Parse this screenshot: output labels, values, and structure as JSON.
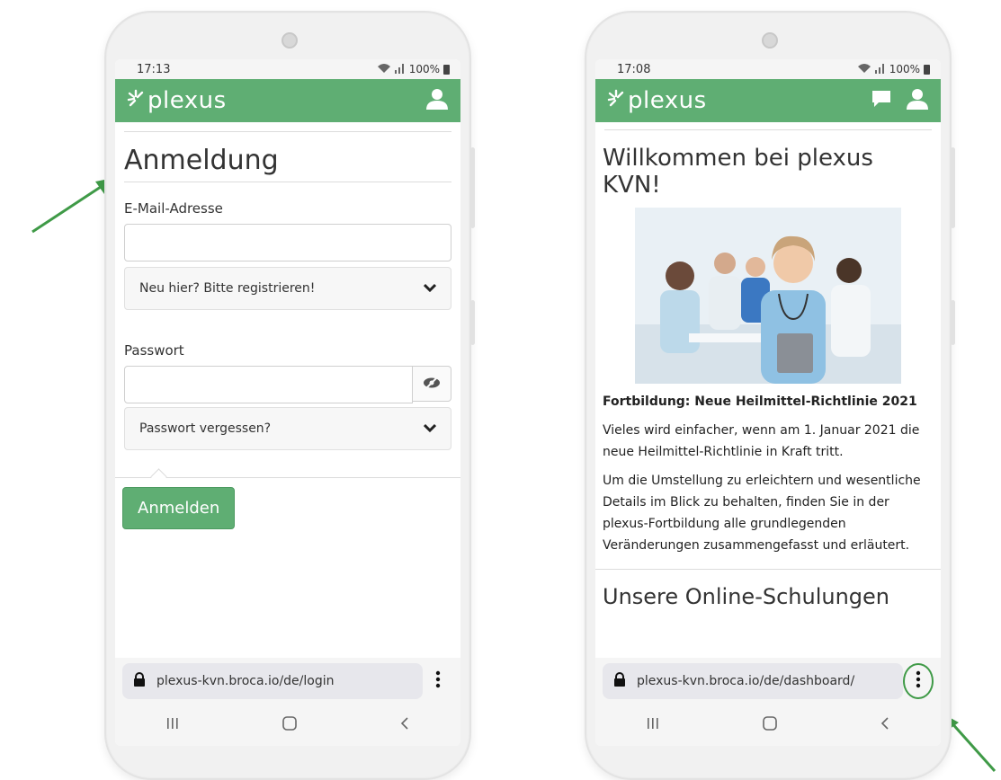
{
  "left_phone": {
    "time": "17:13",
    "battery": "100%",
    "brand": "plexus",
    "heading": "Anmeldung",
    "email_label": "E-Mail-Adresse",
    "register_toggle": "Neu hier? Bitte registrieren!",
    "password_label": "Passwort",
    "forgot_toggle": "Passwort vergessen?",
    "login_button": "Anmelden",
    "url": "plexus-kvn.broca.io/de/login"
  },
  "right_phone": {
    "time": "17:08",
    "battery": "100%",
    "brand": "plexus",
    "welcome": "Willkommen bei plexus KVN!",
    "news_title": "Fortbildung: Neue Heilmittel-Richtlinie 2021",
    "para1": "Vieles wird einfacher, wenn am 1. Januar 2021 die neue Heilmittel-Richtlinie in Kraft tritt.",
    "para2": "Um die Umstellung zu erleichtern und wesentliche Details im Blick zu behalten, finden Sie in der plexus-Fortbildung alle grundlegenden Veränderungen zusammengefasst und erläutert.",
    "section_heading": "Unsere Online-Schulungen",
    "url": "plexus-kvn.broca.io/de/dashboard/"
  },
  "icons": {
    "user": "user-icon",
    "chat": "chat-icon",
    "lock": "lock-icon",
    "eye": "eye-slash-icon",
    "chevron": "chevron-down-icon",
    "kebab": "kebab-menu-icon"
  },
  "colors": {
    "brand_green": "#5fae73",
    "annotation_green": "#3f9a47"
  }
}
